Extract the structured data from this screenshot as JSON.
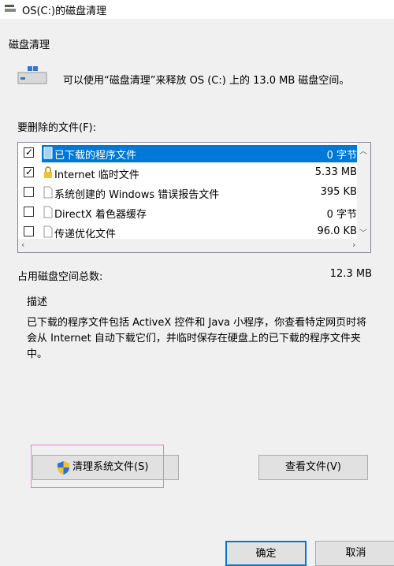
{
  "window": {
    "title": "OS(C:)的磁盘清理"
  },
  "tab": {
    "label": "磁盘清理"
  },
  "intro": {
    "text": "可以使用“磁盘清理”来释放 OS (C:) 上的 13.0 MB 磁盘空间。"
  },
  "list": {
    "label": "要删除的文件(F):",
    "rows": [
      {
        "name": "已下载的程序文件",
        "size": "0 字节",
        "checked": true,
        "selected": true,
        "icon": "folder-icon"
      },
      {
        "name": "Internet 临时文件",
        "size": "5.33 MB",
        "checked": true,
        "selected": false,
        "icon": "lock-icon"
      },
      {
        "name": "系统创建的 Windows 错误报告文件",
        "size": "395 KB",
        "checked": false,
        "selected": false,
        "icon": "file-icon"
      },
      {
        "name": "DirectX 着色器缓存",
        "size": "0 字节",
        "checked": false,
        "selected": false,
        "icon": "file-icon"
      },
      {
        "name": "传递优化文件",
        "size": "96.0 KB",
        "checked": false,
        "selected": false,
        "icon": "file-icon"
      }
    ]
  },
  "total": {
    "label": "占用磁盘空间总数:",
    "value": "12.3 MB"
  },
  "description": {
    "label": "描述",
    "text": "已下载的程序文件包括 ActiveX 控件和 Java 小程序，你查看特定网页时将会从 Internet 自动下载它们，并临时保存在硬盘上的已下载的程序文件夹中。"
  },
  "buttons": {
    "clean_system": "清理系统文件(S)",
    "view_files": "查看文件(V)",
    "ok": "确定",
    "cancel": "取消"
  },
  "colors": {
    "accent": "#0078d7",
    "highlight": "#e27fd9"
  }
}
